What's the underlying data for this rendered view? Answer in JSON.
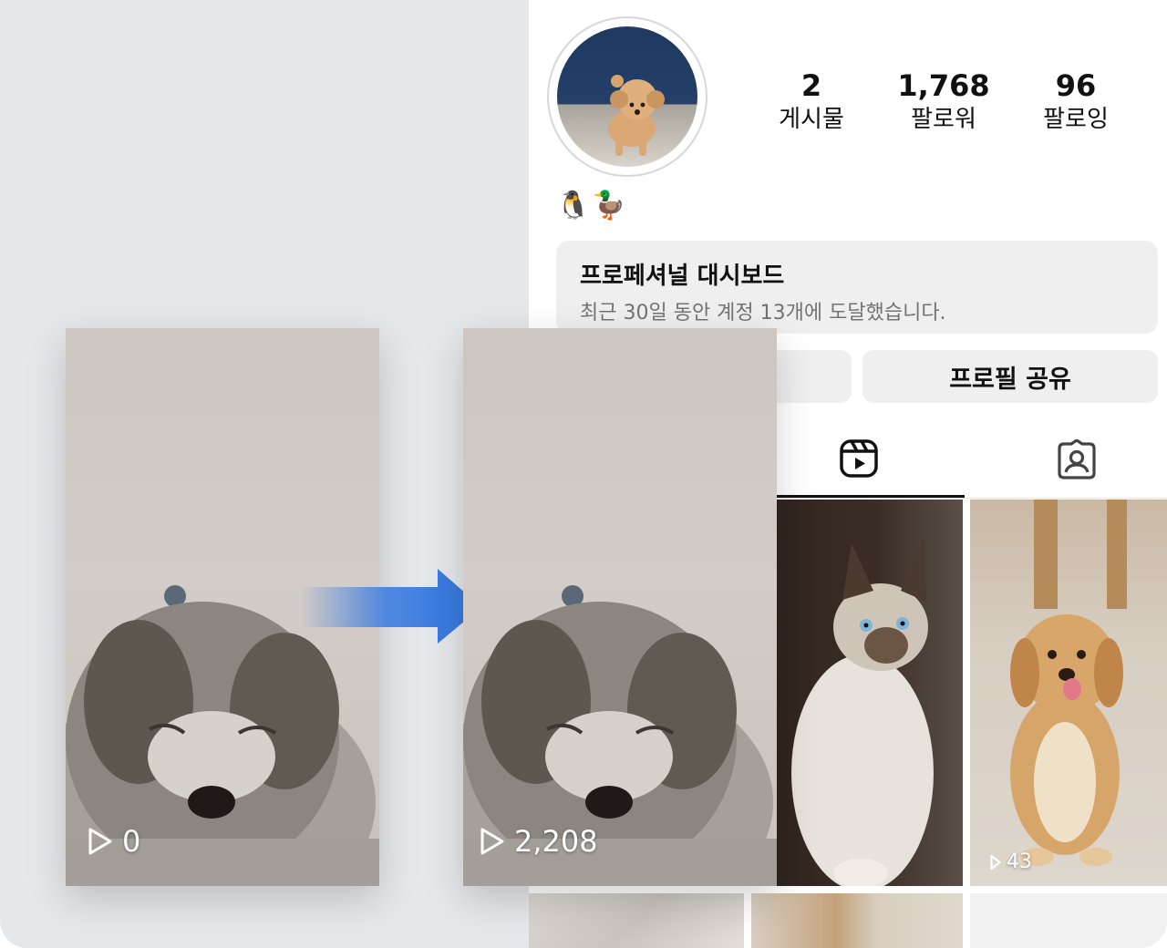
{
  "profile": {
    "stats": [
      {
        "value": "2",
        "label": "게시물"
      },
      {
        "value": "1,768",
        "label": "팔로워"
      },
      {
        "value": "96",
        "label": "팔로잉"
      }
    ],
    "bio_emoji": "🐧🦆"
  },
  "dashboard": {
    "title": "프로페셔널 대시보드",
    "subtitle": "최근 30일 동안 계정 13개에 도달했습니다."
  },
  "buttons": {
    "share_profile": "프로필 공유"
  },
  "tabs": [
    {
      "icon": "reels-icon",
      "active": true
    },
    {
      "icon": "tagged-icon",
      "active": false
    }
  ],
  "grid": {
    "tiles": [
      {
        "subject": "siamese-kitten",
        "views": "0"
      },
      {
        "subject": "golden-retriever-puppy",
        "views": "43"
      }
    ]
  },
  "comparison": {
    "before": {
      "views": "0"
    },
    "after": {
      "views": "2,208"
    },
    "arrow_color": "#3a7be0"
  }
}
